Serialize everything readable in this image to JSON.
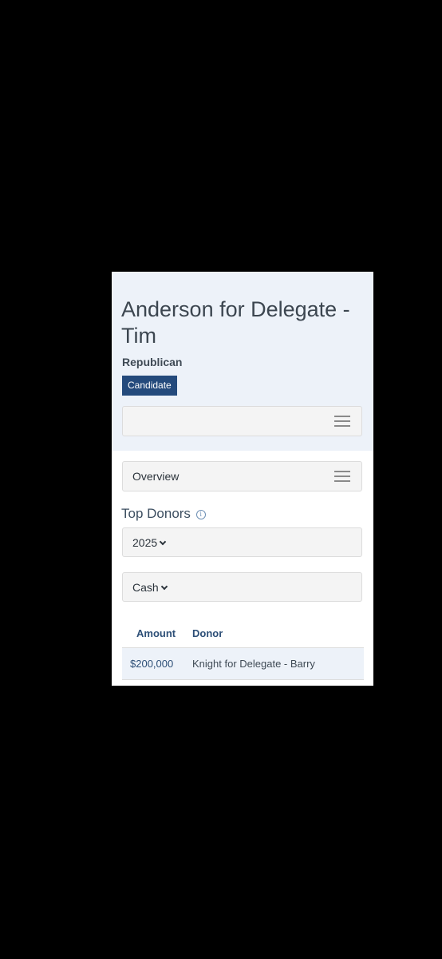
{
  "candidate": {
    "title": "Anderson for Delegate - Tim",
    "party": "Republican",
    "badge": "Candidate"
  },
  "overview_menu": {
    "label": "Overview"
  },
  "top_donors": {
    "title": "Top Donors",
    "info_icon": "i",
    "year_value": "2025",
    "type_value": "Cash",
    "columns": [
      "Amount",
      "Donor"
    ],
    "rows": [
      {
        "amount": "$200,000",
        "donor": "Knight for Delegate - Barry"
      }
    ]
  }
}
